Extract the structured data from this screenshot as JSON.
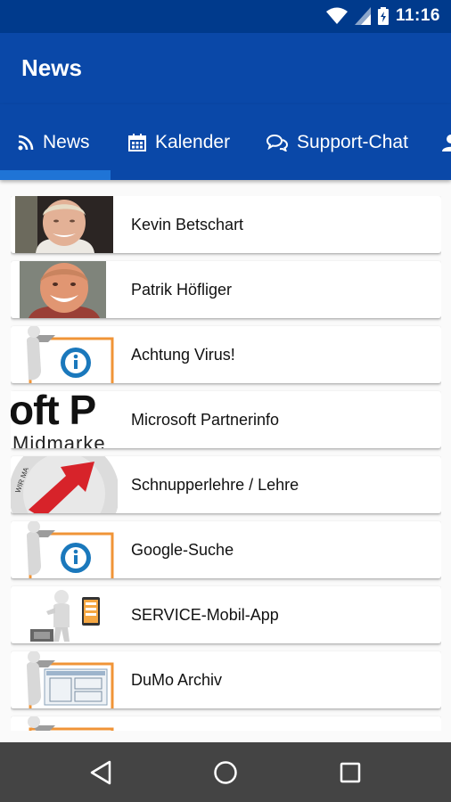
{
  "status_bar": {
    "time": "11:16",
    "icons": [
      "wifi-icon",
      "signal-icon",
      "battery-icon"
    ]
  },
  "app_bar": {
    "title": "News"
  },
  "tabs": [
    {
      "label": "News",
      "icon": "rss-icon",
      "selected": true
    },
    {
      "label": "Kalender",
      "icon": "calendar-icon"
    },
    {
      "label": "Support-Chat",
      "icon": "chat-icon"
    },
    {
      "label": "",
      "icon": "person-icon"
    }
  ],
  "news_items": [
    {
      "title": "Kevin Betschart",
      "thumb": "photo-person"
    },
    {
      "title": "Patrik Höfliger",
      "thumb": "photo-person"
    },
    {
      "title": "Achtung Virus!",
      "thumb": "info-figure"
    },
    {
      "title": "Microsoft Partnerinfo",
      "thumb": "text-logo"
    },
    {
      "title": "Schnupperlehre / Lehre",
      "thumb": "badge-arrow"
    },
    {
      "title": "Google-Suche",
      "thumb": "info-figure"
    },
    {
      "title": "SERVICE-Mobil-App",
      "thumb": "figure-phone"
    },
    {
      "title": "DuMo Archiv",
      "thumb": "figure-board"
    }
  ],
  "thumb_text": {
    "ms_line1": "oft P",
    "ms_line2": "Midmarke"
  },
  "nav_bar": {
    "buttons": [
      "back-icon",
      "home-icon",
      "recents-icon"
    ]
  },
  "colors": {
    "status_bar": "#003a8c",
    "app_bar": "#0a48a8",
    "indicator": "#1f74d6",
    "nav_bar": "#444444"
  }
}
